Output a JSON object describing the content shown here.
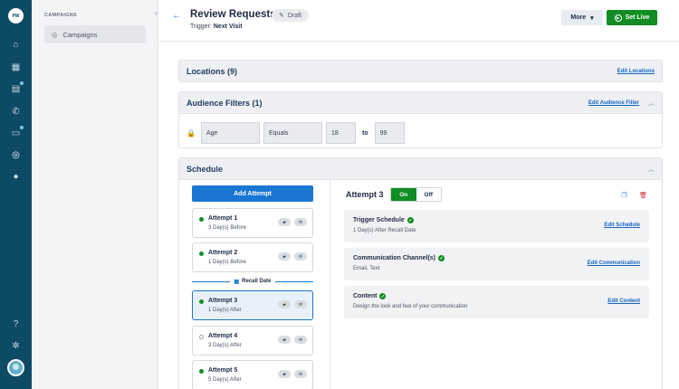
{
  "rail": {
    "logo_text": "PW",
    "icons": [
      "home-icon",
      "calendar-icon",
      "chat-icon",
      "phone-icon",
      "message-icon",
      "campaign-icon",
      "user-icon",
      "help-icon",
      "gear-icon"
    ]
  },
  "subnav": {
    "heading": "CAMPAIGNS",
    "items": [
      {
        "label": "Campaigns"
      }
    ]
  },
  "header": {
    "title": "Review Requests",
    "status": "Draft",
    "trigger_label": "Trigger:",
    "trigger_value": "Next Visit",
    "more_label": "More",
    "set_live_label": "Set Live",
    "accent": "#1976d2",
    "live_color": "#118d23"
  },
  "locations": {
    "title": "Locations (9)",
    "edit_label": "Edit Locations"
  },
  "audience": {
    "title": "Audience Filters (1)",
    "edit_label": "Edit Audience Filter",
    "filter": {
      "field": "Age",
      "operator": "Equals",
      "min": "18",
      "to_label": "to",
      "max": "99"
    }
  },
  "schedule": {
    "title": "Schedule",
    "add_label": "Add Attempt",
    "recall_label": "Recall Date",
    "attempts": [
      {
        "name": "Attempt 1",
        "timing": "3 Day(s) Before",
        "active": true
      },
      {
        "name": "Attempt 2",
        "timing": "1 Day(s) Before",
        "active": true
      },
      {
        "name": "Attempt 3",
        "timing": "1 Day(s) After",
        "active": true
      },
      {
        "name": "Attempt 4",
        "timing": "3 Day(s) After",
        "active": false
      },
      {
        "name": "Attempt 5",
        "timing": "5 Day(s) After",
        "active": true
      }
    ],
    "detail": {
      "title": "Attempt 3",
      "on_label": "On",
      "off_label": "Off",
      "cards": [
        {
          "title": "Trigger Schedule",
          "subtitle": "1 Day(s) After Recall Date",
          "link": "Edit Schedule"
        },
        {
          "title": "Communication Channel(s)",
          "subtitle": "Email, Text",
          "link": "Edit Communication"
        },
        {
          "title": "Content",
          "subtitle": "Design the look and feel of your communication",
          "link": "Edit Content"
        }
      ]
    }
  }
}
